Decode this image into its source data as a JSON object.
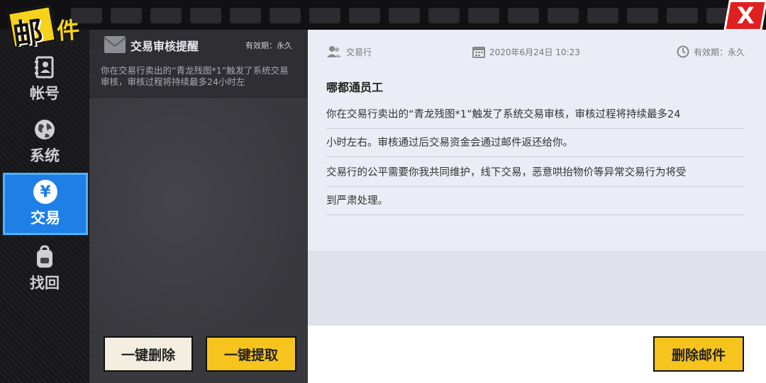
{
  "header": {
    "title_char1": "邮",
    "title_char2": "件",
    "close_glyph": "X"
  },
  "sidebar": {
    "items": [
      {
        "label": "帐号",
        "icon": "account-book-icon",
        "active": false
      },
      {
        "label": "系统",
        "icon": "globe-icon",
        "active": false
      },
      {
        "label": "交易",
        "icon": "yen-icon",
        "glyph": "¥",
        "active": true
      },
      {
        "label": "找回",
        "icon": "backpack-icon",
        "active": false
      }
    ]
  },
  "mail_list": {
    "items": [
      {
        "subject": "交易审核提醒",
        "validity": "有效期：永久",
        "preview": "你在交易行卖出的“青龙残图*1”触发了系统交易审核，审核过程将持续最多24小时左"
      }
    ],
    "delete_all_label": "一键删除",
    "claim_all_label": "一键提取"
  },
  "detail": {
    "sender": "交易行",
    "date": "2020年6月24日  10:23",
    "validity": "有效期：永久",
    "greeting": "哪都通员工",
    "lines": [
      "你在交易行卖出的“青龙残图*1”触发了系统交易审核，审核过程将持续最多24",
      "小时左右。审核通过后交易资金会通过邮件返还给你。",
      "交易行的公平需要你我共同维护，线下交易，恶意哄抬物价等异常交易行为将受",
      "到严肃处理。"
    ],
    "delete_mail_label": "删除邮件"
  },
  "colors": {
    "accent_blue": "#1e7fe6",
    "button_yellow": "#f6c41c",
    "close_red": "#e02020"
  }
}
